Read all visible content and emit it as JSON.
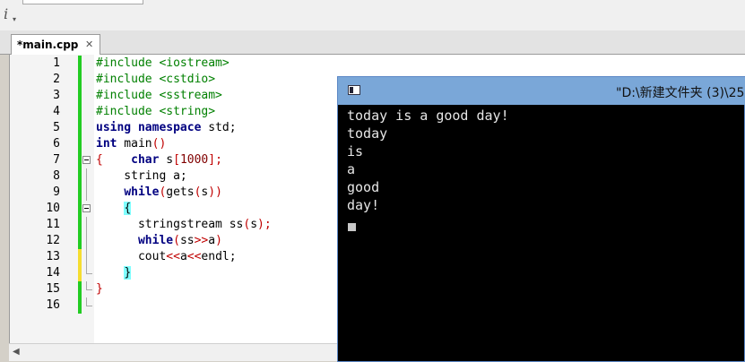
{
  "toolbar": {
    "icon_name": "info-icon",
    "icon_glyph": "i",
    "icon_sub": "▾"
  },
  "tab": {
    "label": "*main.cpp",
    "close": "✕"
  },
  "editor": {
    "lines": [
      {
        "num": "1",
        "tokens": [
          [
            "c-pre",
            "#include <iostream>"
          ]
        ]
      },
      {
        "num": "2",
        "tokens": [
          [
            "c-pre",
            "#include <cstdio>"
          ]
        ]
      },
      {
        "num": "3",
        "tokens": [
          [
            "c-pre",
            "#include <sstream>"
          ]
        ]
      },
      {
        "num": "4",
        "tokens": [
          [
            "c-pre",
            "#include <string>"
          ]
        ]
      },
      {
        "num": "5",
        "tokens": [
          [
            "c-kw",
            "using namespace"
          ],
          [
            "c-id",
            " std;"
          ]
        ]
      },
      {
        "num": "6",
        "tokens": [
          [
            "c-kw",
            "int"
          ],
          [
            "c-id",
            " main"
          ],
          [
            "c-op",
            "()"
          ]
        ]
      },
      {
        "num": "7",
        "tokens": [
          [
            "c-op",
            "{"
          ],
          [
            "c-id",
            "    "
          ],
          [
            "c-kw",
            "char"
          ],
          [
            "c-id",
            " s"
          ],
          [
            "c-op",
            "["
          ],
          [
            "c-num",
            "1000"
          ],
          [
            "c-op",
            "];"
          ]
        ]
      },
      {
        "num": "8",
        "tokens": [
          [
            "c-id",
            "    string a;"
          ]
        ]
      },
      {
        "num": "9",
        "tokens": [
          [
            "c-id",
            "    "
          ],
          [
            "c-kw",
            "while"
          ],
          [
            "c-op",
            "("
          ],
          [
            "c-id",
            "gets"
          ],
          [
            "c-op",
            "("
          ],
          [
            "c-id",
            "s"
          ],
          [
            "c-op",
            "))"
          ]
        ]
      },
      {
        "num": "10",
        "tokens": [
          [
            "c-id",
            "    "
          ],
          [
            "c-brace-hl",
            "{"
          ]
        ]
      },
      {
        "num": "11",
        "tokens": [
          [
            "c-id",
            "      stringstream ss"
          ],
          [
            "c-op",
            "("
          ],
          [
            "c-id",
            "s"
          ],
          [
            "c-op",
            ");"
          ]
        ]
      },
      {
        "num": "12",
        "tokens": [
          [
            "c-id",
            "      "
          ],
          [
            "c-kw",
            "while"
          ],
          [
            "c-op",
            "("
          ],
          [
            "c-id",
            "ss"
          ],
          [
            "c-op",
            ">>"
          ],
          [
            "c-id",
            "a"
          ],
          [
            "c-op",
            ")"
          ]
        ]
      },
      {
        "num": "13",
        "tokens": [
          [
            "c-id",
            "      cout"
          ],
          [
            "c-op",
            "<<"
          ],
          [
            "c-id",
            "a"
          ],
          [
            "c-op",
            "<<"
          ],
          [
            "c-id",
            "endl;"
          ]
        ]
      },
      {
        "num": "14",
        "tokens": [
          [
            "c-id",
            "    "
          ],
          [
            "c-brace-hl",
            "}"
          ]
        ]
      },
      {
        "num": "15",
        "tokens": [
          [
            "c-op",
            "}"
          ]
        ]
      },
      {
        "num": "16",
        "tokens": []
      }
    ],
    "change_colors": {
      "saved": "#22cc22",
      "modified": "#f5dd30"
    }
  },
  "console": {
    "title": "\"D:\\新建文件夹 (3)\\25",
    "output": [
      "today is a good day!",
      "today",
      "is",
      "a",
      "good",
      "day!"
    ]
  }
}
